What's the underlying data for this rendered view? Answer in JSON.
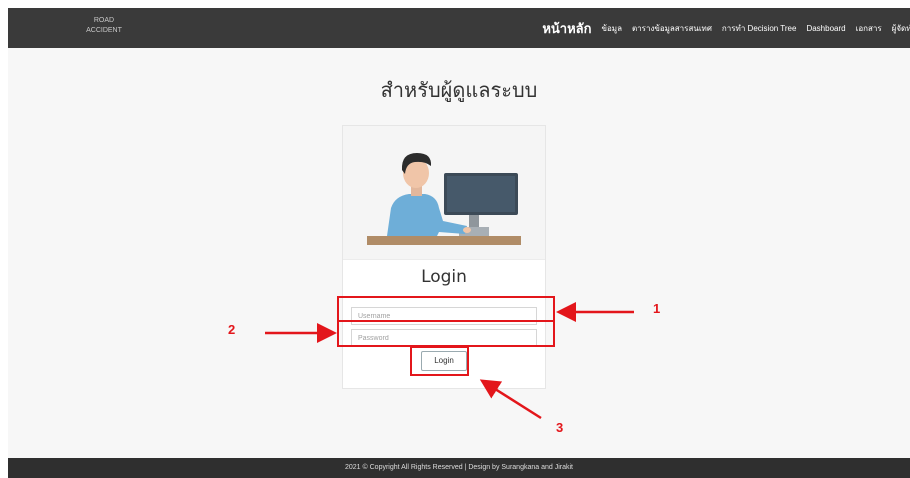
{
  "navbar": {
    "brand_line1": "ROAD",
    "brand_line2": "ACCIDENT",
    "items": [
      {
        "label": "หน้าหลัก"
      },
      {
        "label": "ข้อมูล"
      },
      {
        "label": "ตารางข้อมูลสารสนเทศ"
      },
      {
        "label": "การทำ Decision Tree"
      },
      {
        "label": "Dashboard"
      },
      {
        "label": "เอกสาร"
      },
      {
        "label": "ผู้จัดทำ"
      }
    ]
  },
  "main": {
    "title": "สำหรับผู้ดูแลระบบ",
    "login_card": {
      "title": "Login",
      "username_placeholder": "Username",
      "password_placeholder": "Password",
      "button_label": "Login"
    }
  },
  "footer": {
    "text": "2021 © Copyright All Rights Reserved | Design by Surangkana and Jirakit"
  },
  "annotations": {
    "label_1": "1",
    "label_2": "2",
    "label_3": "3"
  },
  "colors": {
    "annotation": "#e3161b",
    "navbar_bg": "#3a3a3a",
    "footer_bg": "#2f2f2f"
  }
}
